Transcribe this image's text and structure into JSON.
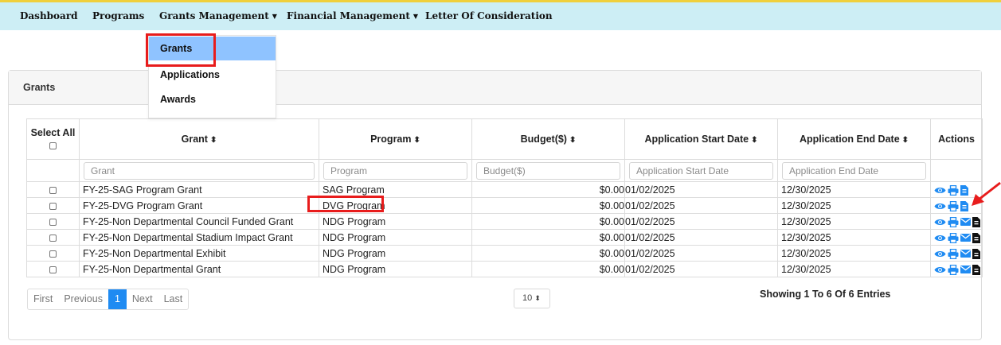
{
  "nav": {
    "dashboard": "Dashboard",
    "programs": "Programs",
    "grants_management": "Grants Management",
    "financial_management": "Financial Management",
    "letter": "Letter Of Consideration"
  },
  "dropdown": {
    "items": [
      "Grants",
      "Applications",
      "Awards"
    ],
    "active": "Grants"
  },
  "card": {
    "title": "Grants"
  },
  "table": {
    "select_all": "Select All",
    "headers": {
      "grant": "Grant",
      "program": "Program",
      "budget": "Budget($)",
      "start": "Application Start Date",
      "end": "Application End Date",
      "actions": "Actions"
    },
    "filters": {
      "grant": "Grant",
      "program": "Program",
      "budget": "Budget($)",
      "start": "Application Start Date",
      "end": "Application End Date"
    },
    "rows": [
      {
        "grant": "FY-25-SAG Program Grant",
        "program": "SAG Program",
        "budget": "$0.00",
        "start": "01/02/2025",
        "end": "12/30/2025",
        "email": false
      },
      {
        "grant": "FY-25-DVG Program Grant",
        "program": "DVG Program",
        "budget": "$0.00",
        "start": "01/02/2025",
        "end": "12/30/2025",
        "email": false
      },
      {
        "grant": "FY-25-Non Departmental Council Funded Grant",
        "program": "NDG Program",
        "budget": "$0.00",
        "start": "01/02/2025",
        "end": "12/30/2025",
        "email": true
      },
      {
        "grant": "FY-25-Non Departmental Stadium Impact Grant",
        "program": "NDG Program",
        "budget": "$0.00",
        "start": "01/02/2025",
        "end": "12/30/2025",
        "email": true
      },
      {
        "grant": "FY-25-Non Departmental Exhibit",
        "program": "NDG Program",
        "budget": "$0.00",
        "start": "01/02/2025",
        "end": "12/30/2025",
        "email": true
      },
      {
        "grant": "FY-25-Non Departmental Grant",
        "program": "NDG Program",
        "budget": "$0.00",
        "start": "01/02/2025",
        "end": "12/30/2025",
        "email": true
      }
    ]
  },
  "pagination": {
    "first": "First",
    "previous": "Previous",
    "current": "1",
    "next": "Next",
    "last": "Last",
    "page_size": "10",
    "entries": "Showing 1 To 6 Of 6 Entries"
  },
  "icons": {
    "view": "eye-icon",
    "print": "print-icon",
    "email": "envelope-icon",
    "doc": "document-icon",
    "sort": "sort-icon"
  },
  "colors": {
    "topbar": "#cdeef5",
    "topbar_border": "#f0cf3c",
    "highlight": "#e81c1c",
    "accent": "#1f8bf2",
    "dropdown_active": "#8fc3ff"
  }
}
